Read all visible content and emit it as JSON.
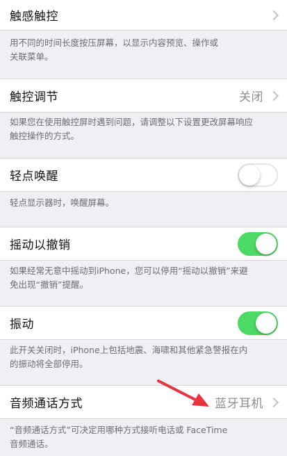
{
  "colors": {
    "background": "#efeff4",
    "row_bg": "#ffffff",
    "toggle_on": "#4cd964",
    "secondary_text": "#8e8e93",
    "footnote_text": "#6d6d72",
    "annotation_arrow": "#e8323c"
  },
  "settings": {
    "touch_3d": {
      "label": "触感触控",
      "note": "用不同的时间长度按压屏幕，以显示内容预览、操作或\n关联菜单。"
    },
    "touch_accommodations": {
      "label": "触控调节",
      "value": "关闭",
      "note": "如果您在使用触控屏时遇到问题，请调整以下设置更改屏幕响应\n触控操作的方式。"
    },
    "tap_to_wake": {
      "label": "轻点唤醒",
      "toggle": "off",
      "note": "轻点显示器时，唤醒屏幕。"
    },
    "shake_to_undo": {
      "label": "摇动以撤销",
      "toggle": "on",
      "note": "如果经常无意中摇动到iPhone，您可以停用“摇动以撤销”来避\n免出现“撤销”提醒。"
    },
    "vibration": {
      "label": "振动",
      "toggle": "on",
      "note": "此开关关闭时，iPhone上包括地震、海啸和其他紧急警报在内\n的振动将全部停用。"
    },
    "call_audio_routing": {
      "label": "音频通话方式",
      "value": "蓝牙耳机",
      "note": "“音频通话方式”可决定用哪种方式接听电话或 FaceTime\n音频通话。"
    }
  },
  "icons": [
    "chevron-right-icon",
    "red-arrow-annotation"
  ]
}
